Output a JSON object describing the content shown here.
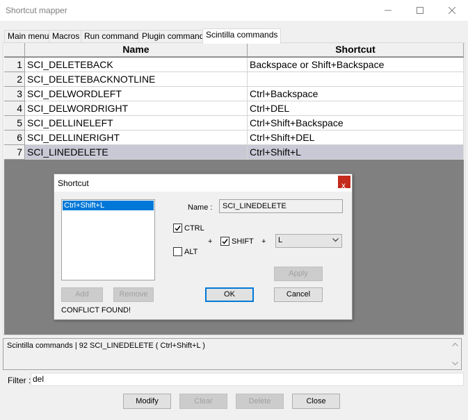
{
  "window": {
    "title": "Shortcut mapper"
  },
  "tabs": [
    {
      "label": "Main menu"
    },
    {
      "label": "Macros"
    },
    {
      "label": "Run commands"
    },
    {
      "label": "Plugin commands"
    },
    {
      "label": "Scintilla commands",
      "active": true
    }
  ],
  "grid": {
    "columns": {
      "name": "Name",
      "shortcut": "Shortcut"
    },
    "rows": [
      {
        "num": "1",
        "name": "SCI_DELETEBACK",
        "shortcut": "Backspace or Shift+Backspace"
      },
      {
        "num": "2",
        "name": "SCI_DELETEBACKNOTLINE",
        "shortcut": ""
      },
      {
        "num": "3",
        "name": "SCI_DELWORDLEFT",
        "shortcut": "Ctrl+Backspace"
      },
      {
        "num": "4",
        "name": "SCI_DELWORDRIGHT",
        "shortcut": "Ctrl+DEL"
      },
      {
        "num": "5",
        "name": "SCI_DELLINELEFT",
        "shortcut": "Ctrl+Shift+Backspace"
      },
      {
        "num": "6",
        "name": "SCI_DELLINERIGHT",
        "shortcut": "Ctrl+Shift+DEL"
      },
      {
        "num": "7",
        "name": "SCI_LINEDELETE",
        "shortcut": "Ctrl+Shift+L",
        "selected": true
      }
    ]
  },
  "dialog": {
    "title": "Shortcut",
    "close_glyph": "x",
    "list_items": [
      "Ctrl+Shift+L"
    ],
    "add_label": "Add",
    "remove_label": "Remove",
    "conflict_text": "CONFLICT FOUND!",
    "name_label": "Name :",
    "name_value": "SCI_LINEDELETE",
    "ctrl_label": "CTRL",
    "ctrl_checked": true,
    "alt_label": "ALT",
    "alt_checked": false,
    "shift_label": "SHIFT",
    "shift_checked": true,
    "plus": "+",
    "key_value": "L",
    "apply_label": "Apply",
    "ok_label": "OK",
    "cancel_label": "Cancel"
  },
  "status": {
    "text": "Scintilla commands  |  92   SCI_LINEDELETE  ( Ctrl+Shift+L )"
  },
  "filter": {
    "label": "Filter :",
    "value": "del"
  },
  "buttons": {
    "modify": "Modify",
    "clear": "Clear",
    "delete": "Delete",
    "close": "Close"
  }
}
